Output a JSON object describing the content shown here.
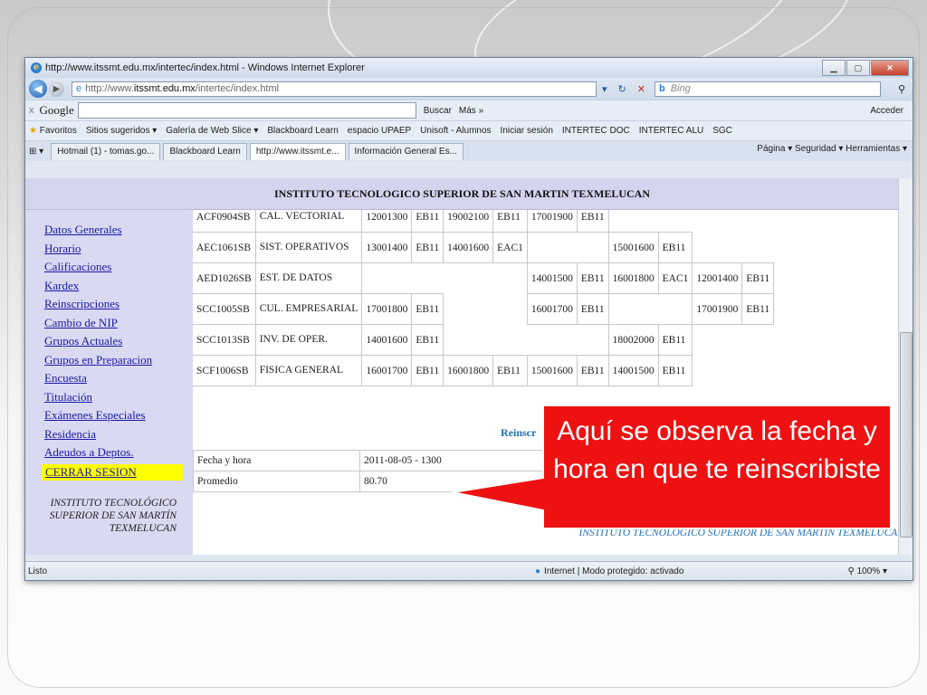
{
  "window": {
    "title": "http://www.itssmt.edu.mx/intertec/index.html - Windows Internet Explorer",
    "address_prefix": "http://www.",
    "address_host": "itssmt.edu.mx",
    "address_path": "/intertec/index.html",
    "search_placeholder": "Bing",
    "min_label": "▁",
    "max_label": "▢",
    "close_label": "✕"
  },
  "google_toolbar": {
    "close": "x",
    "logo": "Google",
    "search_button": "Buscar",
    "more": "Más »",
    "signin": "Acceder"
  },
  "favorites": {
    "label": "Favoritos",
    "items": [
      "Sitios sugeridos ▾",
      "Galería de Web Slice ▾",
      "Blackboard Learn",
      "espacio UPAEP",
      "Unisoft - Alumnos",
      "Iniciar sesión",
      "INTERTEC DOC",
      "INTERTEC ALU",
      "SGC"
    ]
  },
  "tabs": {
    "items": [
      "Hotmail (1) - tomas.go...",
      "Blackboard Learn",
      "http://www.itssmt.e...",
      "Información General Es..."
    ],
    "commands": "Página ▾   Seguridad ▾   Herramientas ▾"
  },
  "page": {
    "banner": "INSTITUTO TECNOLOGICO SUPERIOR DE SAN MARTIN TEXMELUCAN",
    "menu": [
      "Datos Generales",
      "Horario",
      "Calificaciones",
      "Kardex",
      "Reinscripciones",
      "Cambio de NIP",
      "Grupos Actuales",
      "Grupos en Preparacion",
      "Encuesta",
      "Titulación",
      "Exámenes Especiales",
      "Residencia",
      "Adeudos a Deptos."
    ],
    "logout": "CERRAR SESION",
    "institution": "INSTITUTO TECNOLÓGICO SUPERIOR DE SAN MARTÍN TEXMELUCAN",
    "schedule_rows": [
      {
        "code": "ACF0904SB",
        "subject": "CAL. VECTORIAL",
        "cells": [
          "12001300",
          "EB11",
          "19002100",
          "EB11",
          "17001900",
          "EB11",
          "",
          "",
          "",
          ""
        ]
      },
      {
        "code": "AEC1061SB",
        "subject": "SIST. OPERATIVOS",
        "cells": [
          "13001400",
          "EB11",
          "14001600",
          "EAC1",
          "",
          "",
          "15001600",
          "EB11",
          "",
          ""
        ]
      },
      {
        "code": "AED1026SB",
        "subject": "EST. DE DATOS",
        "cells": [
          "",
          "",
          "",
          "",
          "14001500",
          "EB11",
          "16001800",
          "EAC1",
          "12001400",
          "EB11"
        ]
      },
      {
        "code": "SCC1005SB",
        "subject": "CUL. EMPRESARIAL",
        "cells": [
          "17001800",
          "EB11",
          "",
          "",
          "16001700",
          "EB11",
          "",
          "",
          "17001900",
          "EB11"
        ]
      },
      {
        "code": "SCC1013SB",
        "subject": "INV. DE OPER.",
        "cells": [
          "14001600",
          "EB11",
          "",
          "",
          "",
          "",
          "18002000",
          "EB11",
          "",
          ""
        ]
      },
      {
        "code": "SCF1006SB",
        "subject": "FISICA GENERAL",
        "cells": [
          "16001700",
          "EB11",
          "16001800",
          "EB11",
          "15001600",
          "EB11",
          "14001500",
          "EB11",
          "",
          ""
        ]
      }
    ],
    "reinscripcion_label": "Reinscr",
    "info": [
      {
        "label": "Fecha y hora",
        "value": "2011-08-05 - 1300"
      },
      {
        "label": "Promedio",
        "value": "80.70"
      }
    ],
    "footer": "INSTITUTO TECNOLÓGICO SUPERIOR DE SAN MARTÍN TEXMELUCAN"
  },
  "status": {
    "left": "Listo",
    "zone": "Internet | Modo protegido: activado",
    "zoom": "100%"
  },
  "callout": {
    "text": "Aquí se observa la fecha y hora en que te reinscribiste",
    "color": "#ee1111"
  }
}
